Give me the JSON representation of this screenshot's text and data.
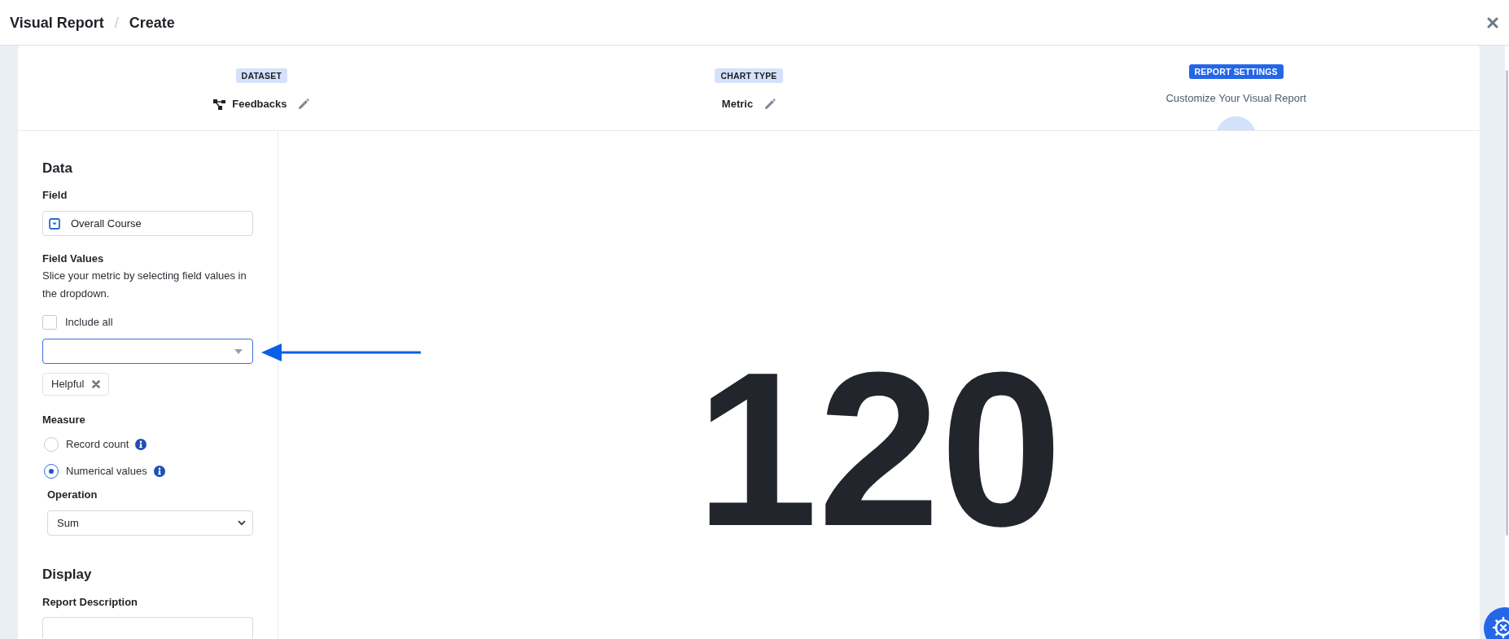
{
  "header": {
    "breadcrumb": [
      {
        "label": "Visual Report"
      },
      {
        "label": "Create"
      }
    ],
    "separator": "/"
  },
  "steps": [
    {
      "kind": "dataset",
      "badge": "DATASET",
      "value": "Feedbacks",
      "editable": true,
      "active": false
    },
    {
      "kind": "chart_type",
      "badge": "CHART TYPE",
      "value": "Metric",
      "editable": true,
      "active": false
    },
    {
      "kind": "settings",
      "badge": "REPORT SETTINGS",
      "subtitle": "Customize Your Visual Report",
      "active": true
    }
  ],
  "data_section": {
    "heading": "Data",
    "field": {
      "label": "Field",
      "value": "Overall Course"
    },
    "field_values": {
      "label": "Field Values",
      "help": "Slice your metric by selecting field values in the dropdown.",
      "include_all": {
        "label": "Include all",
        "checked": false
      },
      "select": {
        "focused": true
      },
      "tags": [
        {
          "label": "Helpful"
        }
      ]
    },
    "measure": {
      "label": "Measure",
      "options": [
        {
          "label": "Record count",
          "selected": false
        },
        {
          "label": "Numerical values",
          "selected": true
        }
      ]
    },
    "operation": {
      "label": "Operation",
      "value": "Sum"
    }
  },
  "display_section": {
    "heading": "Display",
    "description": {
      "label": "Report Description"
    }
  },
  "metric": {
    "value": "120"
  }
}
